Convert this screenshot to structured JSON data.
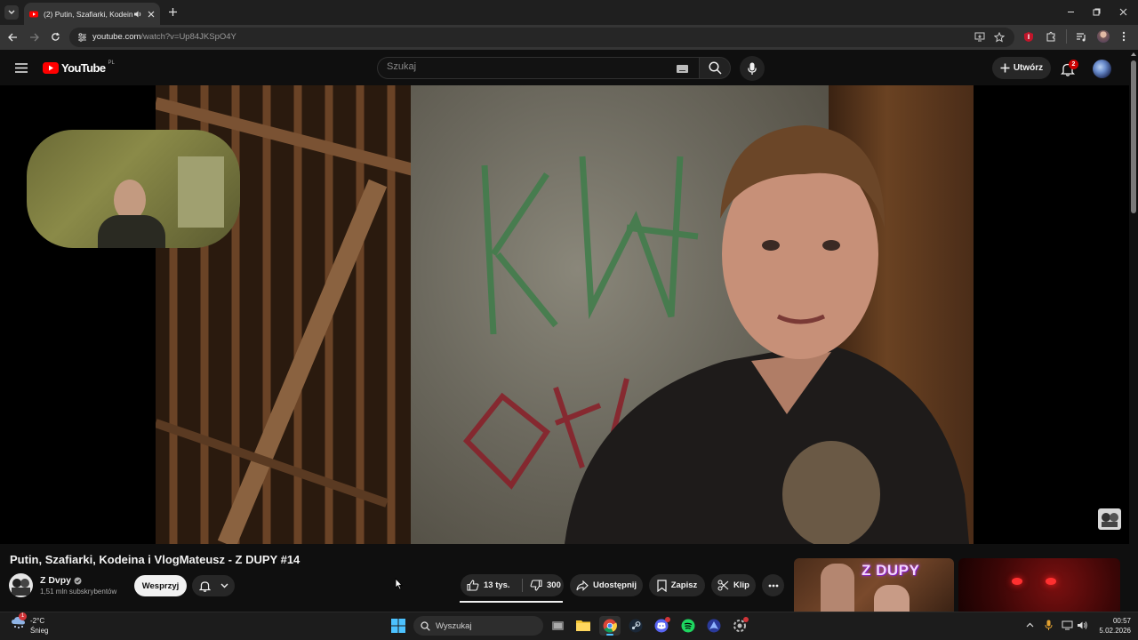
{
  "browser": {
    "tab": {
      "title": "(2) Putin, Szafiarki, Kodeina"
    },
    "url": {
      "host": "youtube.com",
      "path": "/watch?v=Up84JKSpO4Y"
    }
  },
  "youtube": {
    "logo_text": "YouTube",
    "country": "PL",
    "search": {
      "placeholder": "Szukaj"
    },
    "create_label": "Utwórz",
    "notifications_count": "2"
  },
  "video": {
    "title": "Putin, Szafiarki, Kodeina i VlogMateusz - Z DUPY #14",
    "channel": {
      "name": "Z Dvpy",
      "subscribers": "1,51 mln subskrybentów"
    },
    "subscribe_label": "Wesprzyj",
    "likes": "13 tys.",
    "dislikes": "300",
    "share_label": "Udostępnij",
    "save_label": "Zapisz",
    "clip_label": "Klip",
    "recommendation_text": "Z DUPY"
  },
  "taskbar": {
    "weather": {
      "temp": "-2°C",
      "condition": "Śnieg",
      "badge": "1"
    },
    "search_label": "Wyszukaj",
    "time": "00:57",
    "date": "5.02.2026"
  },
  "colors": {
    "youtube_red": "#ff0000",
    "background": "#0f0f0f",
    "pill": "#272727"
  }
}
